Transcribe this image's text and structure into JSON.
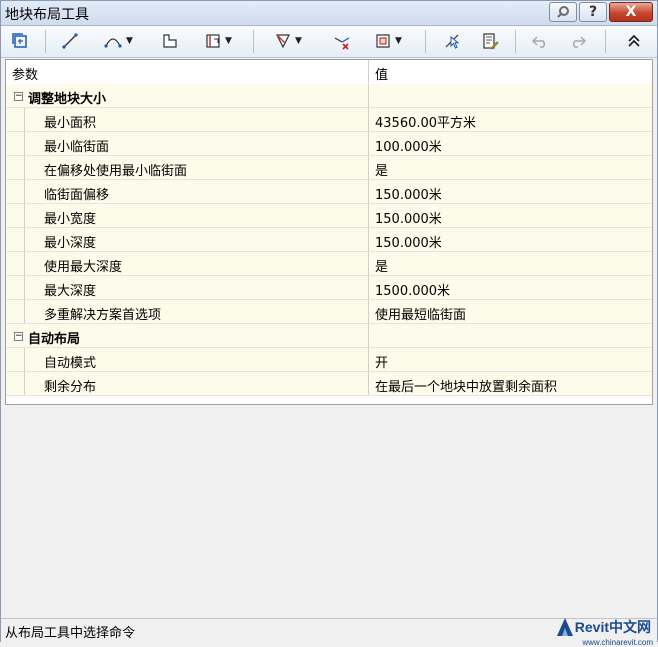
{
  "window": {
    "title": "地块布局工具"
  },
  "titlebar_buttons": [
    {
      "name": "help-search-button",
      "icon": "key-icon"
    },
    {
      "name": "help-button",
      "label": "?"
    },
    {
      "name": "close-button",
      "label": "X"
    }
  ],
  "grid": {
    "col_param": "参数",
    "col_value": "值",
    "sections": [
      {
        "label": "调整地块大小",
        "rows": [
          {
            "name": "最小面积",
            "value": "43560.00平方米"
          },
          {
            "name": "最小临街面",
            "value": "100.000米"
          },
          {
            "name": "在偏移处使用最小临街面",
            "value": "是"
          },
          {
            "name": "临街面偏移",
            "value": "150.000米"
          },
          {
            "name": "最小宽度",
            "value": "150.000米"
          },
          {
            "name": "最小深度",
            "value": "150.000米"
          },
          {
            "name": "使用最大深度",
            "value": "是"
          },
          {
            "name": "最大深度",
            "value": "1500.000米"
          },
          {
            "name": "多重解决方案首选项",
            "value": "使用最短临街面"
          }
        ]
      },
      {
        "label": "自动布局",
        "rows": [
          {
            "name": "自动模式",
            "value": "开"
          },
          {
            "name": "剩余分布",
            "value": "在最后一个地块中放置剩余面积"
          }
        ]
      }
    ]
  },
  "statusbar": {
    "text": "从布局工具中选择命令"
  },
  "watermark": {
    "brand": "Revit",
    "cn": "中文网",
    "url": "www.chinarevit.com"
  }
}
